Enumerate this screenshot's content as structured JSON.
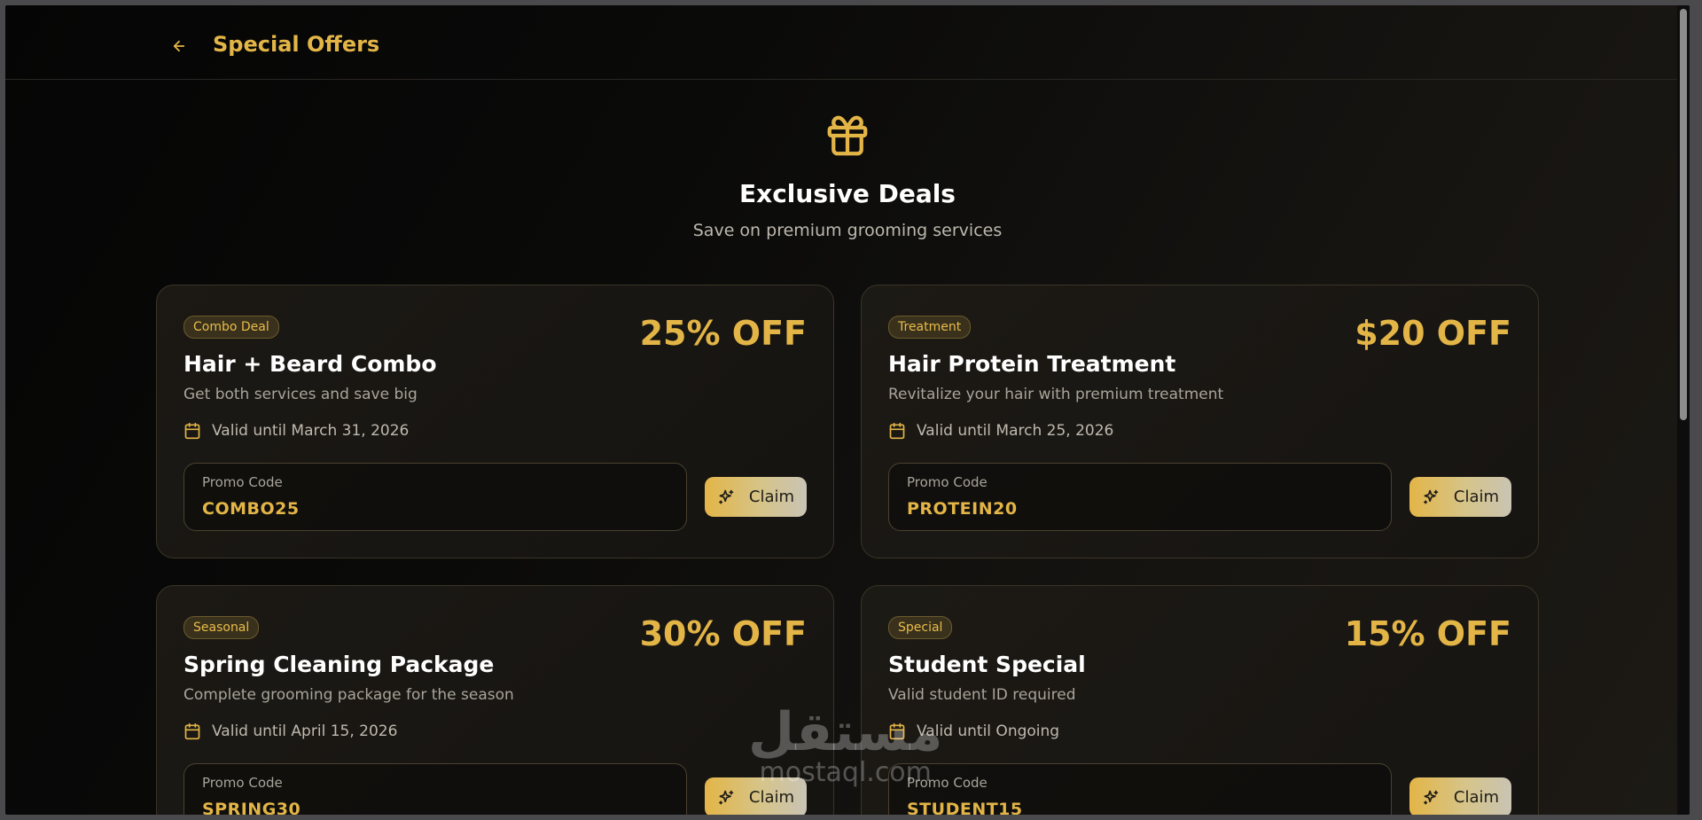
{
  "header": {
    "title": "Special Offers",
    "back_icon": "arrow-left-icon"
  },
  "hero": {
    "icon": "gift-icon",
    "title": "Exclusive Deals",
    "subtitle": "Save on premium grooming services"
  },
  "colors": {
    "accent": "#e3b547",
    "background": "#0a0a09",
    "card_border": "#3b3426"
  },
  "offers": [
    {
      "badge": "Combo Deal",
      "discount": "25% OFF",
      "title": "Hair + Beard Combo",
      "description": "Get both services and save big",
      "validity": "Valid until March 31, 2026",
      "promo_label": "Promo Code",
      "promo_code": "COMBO25",
      "claim_label": "Claim"
    },
    {
      "badge": "Treatment",
      "discount": "$20 OFF",
      "title": "Hair Protein Treatment",
      "description": "Revitalize your hair with premium treatment",
      "validity": "Valid until March 25, 2026",
      "promo_label": "Promo Code",
      "promo_code": "PROTEIN20",
      "claim_label": "Claim"
    },
    {
      "badge": "Seasonal",
      "discount": "30% OFF",
      "title": "Spring Cleaning Package",
      "description": "Complete grooming package for the season",
      "validity": "Valid until April 15, 2026",
      "promo_label": "Promo Code",
      "promo_code": "SPRING30",
      "claim_label": "Claim"
    },
    {
      "badge": "Special",
      "discount": "15% OFF",
      "title": "Student Special",
      "description": "Valid student ID required",
      "validity": "Valid until Ongoing",
      "promo_label": "Promo Code",
      "promo_code": "STUDENT15",
      "claim_label": "Claim"
    }
  ],
  "watermark": {
    "main": "مستقل",
    "sub": "mostaql.com"
  }
}
